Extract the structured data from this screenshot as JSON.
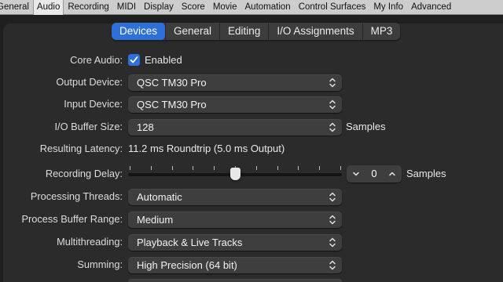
{
  "categories": [
    "General",
    "Audio",
    "Recording",
    "MIDI",
    "Display",
    "Score",
    "Movie",
    "Automation",
    "Control Surfaces",
    "My Info",
    "Advanced"
  ],
  "active_category": "Audio",
  "tabs": [
    "Devices",
    "General",
    "Editing",
    "I/O Assignments",
    "MP3"
  ],
  "active_tab": "Devices",
  "core_audio": {
    "label": "Core Audio:",
    "checkbox_label": "Enabled",
    "checked": true
  },
  "output_device": {
    "label": "Output Device:",
    "value": "QSC TM30 Pro"
  },
  "input_device": {
    "label": "Input Device:",
    "value": "QSC TM30 Pro"
  },
  "io_buffer": {
    "label": "I/O Buffer Size:",
    "value": "128",
    "unit": "Samples"
  },
  "latency": {
    "label": "Resulting Latency:",
    "value": "11.2 ms Roundtrip (5.0 ms Output)"
  },
  "recording_delay": {
    "label": "Recording Delay:",
    "value": "0",
    "unit": "Samples",
    "slider_fraction": 0.5
  },
  "processing_threads": {
    "label": "Processing Threads:",
    "value": "Automatic"
  },
  "process_buffer_range": {
    "label": "Process Buffer Range:",
    "value": "Medium"
  },
  "multithreading": {
    "label": "Multithreading:",
    "value": "Playback & Live Tracks"
  },
  "summing": {
    "label": "Summing:",
    "value": "High Precision (64 bit)"
  },
  "accent_color": "#2e6fd8"
}
